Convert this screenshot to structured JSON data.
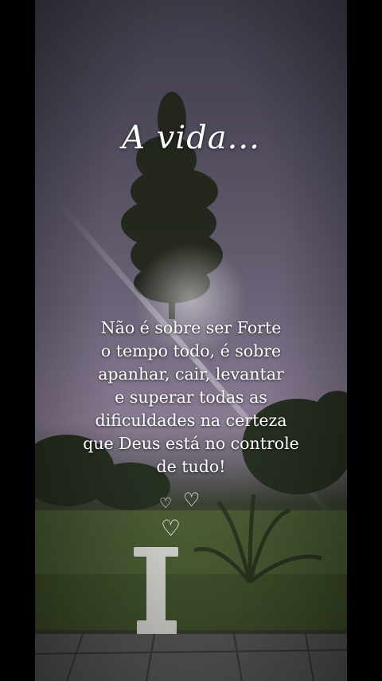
{
  "post": {
    "title": "A vida...",
    "message_lines": [
      "Não é sobre ser Forte",
      "o tempo todo, é sobre",
      "apanhar, cair, levantar",
      "e superar todas as",
      "dificuldades na certeza",
      "que Deus está no controle",
      "de tudo!"
    ]
  },
  "decorations": {
    "hearts_icon": "heart-outline-icon",
    "heart_color": "#ffffff",
    "sky_color": "#6b6377",
    "grass_color": "#4c5b33"
  }
}
